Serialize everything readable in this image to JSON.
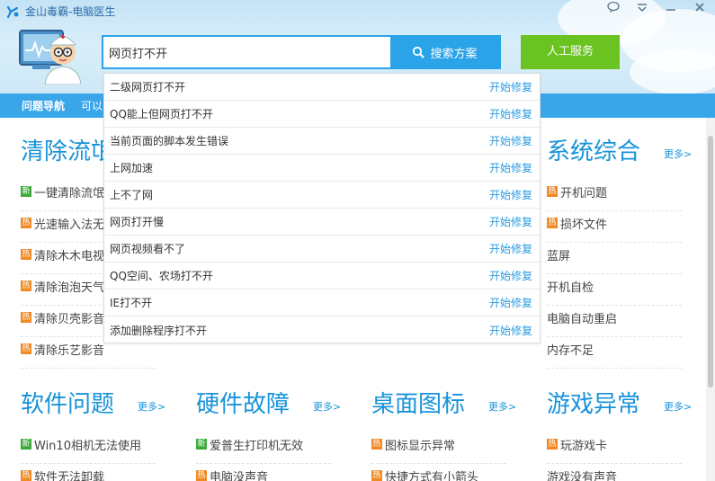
{
  "app": {
    "title": "金山毒霸-电脑医生",
    "logo_icon": "kingsoft-logo-icon"
  },
  "window_controls": [
    "chat-icon",
    "menu-icon",
    "minimize-icon",
    "close-icon"
  ],
  "search": {
    "value": "网页打不开",
    "button_label": "搜索方案"
  },
  "service_button": "人工服务",
  "nav": {
    "label": "问题导航",
    "text": "可以"
  },
  "dropdown": {
    "fix_label": "开始修复",
    "items": [
      "二级网页打不开",
      "QQ能上但网页打不开",
      "当前页面的脚本发生错误",
      "上网加速",
      "上不了网",
      "网页打开慢",
      "网页视频看不了",
      "QQ空间、农场打不开",
      "IE打不开",
      "添加删除程序打不开"
    ]
  },
  "more_label": "更多>",
  "badges": {
    "new": "新",
    "hot": "热"
  },
  "sections": {
    "clean": {
      "title": "清除流氓",
      "items": [
        {
          "badge": "new",
          "text": "一键清除流氓"
        },
        {
          "badge": "hot",
          "text": "光速输入法无"
        },
        {
          "badge": "hot",
          "text": "清除木木电视"
        },
        {
          "badge": "hot",
          "text": "清除泡泡天气"
        },
        {
          "badge": "hot",
          "text": "清除贝壳影音"
        },
        {
          "badge": "hot",
          "text": "清除乐艺影音"
        }
      ]
    },
    "system": {
      "title": "系统综合",
      "items": [
        {
          "badge": "hot",
          "text": "开机问题"
        },
        {
          "badge": "hot",
          "text": "损坏文件"
        },
        {
          "badge": "",
          "text": "蓝屏"
        },
        {
          "badge": "",
          "text": "开机自检"
        },
        {
          "badge": "",
          "text": "电脑自动重启"
        },
        {
          "badge": "",
          "text": "内存不足"
        }
      ]
    },
    "software": {
      "title": "软件问题",
      "items": [
        {
          "badge": "new",
          "text": "Win10相机无法使用"
        },
        {
          "badge": "hot",
          "text": "软件无法卸载"
        }
      ]
    },
    "hardware": {
      "title": "硬件故障",
      "items": [
        {
          "badge": "new",
          "text": "爱普生打印机无效"
        },
        {
          "badge": "hot",
          "text": "电脑没声音"
        }
      ]
    },
    "desktop": {
      "title": "桌面图标",
      "items": [
        {
          "badge": "hot",
          "text": "图标显示异常"
        },
        {
          "badge": "hot",
          "text": "快捷方式有小箭头"
        }
      ]
    },
    "game": {
      "title": "游戏异常",
      "items": [
        {
          "badge": "hot",
          "text": "玩游戏卡"
        },
        {
          "badge": "",
          "text": "游戏没有声音"
        }
      ]
    }
  },
  "colors": {
    "accent": "#2aa3e8",
    "title_blue": "#1893d9",
    "service_green": "#6ac321",
    "new_badge": "#3aab3a",
    "hot_badge": "#f08a24"
  }
}
